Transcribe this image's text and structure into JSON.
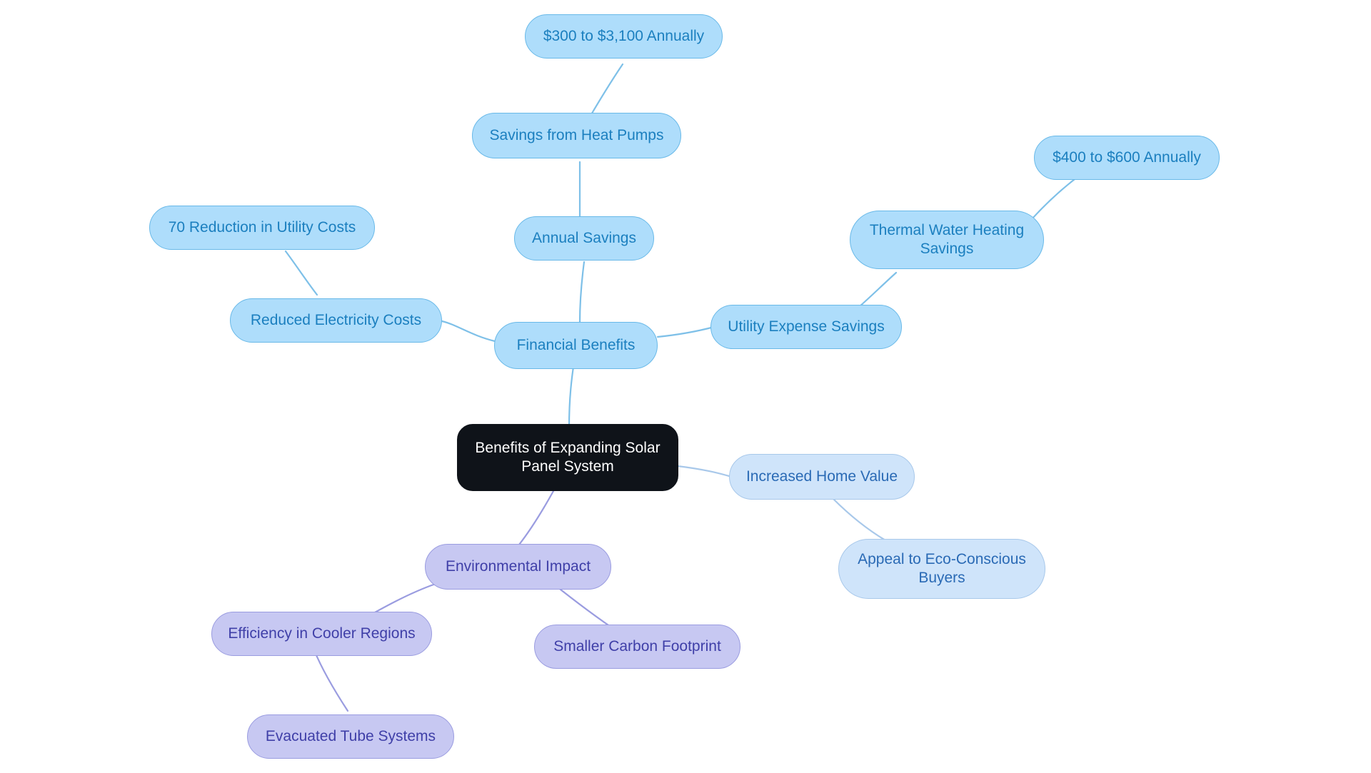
{
  "diagram": {
    "type": "mind-map",
    "title": "Benefits of Expanding Solar Panel System",
    "background_color": "#ffffff",
    "palette": {
      "root_fill": "#0f1319",
      "root_text": "#ffffff",
      "financial_fill": "#aeddfb",
      "financial_border": "#69b9e8",
      "financial_text": "#1b7fbf",
      "home_value_fill": "#cfe4fa",
      "home_value_border": "#a8c8ea",
      "home_value_text": "#2a6ab5",
      "environment_fill": "#c7c8f2",
      "environment_border": "#9a9ce0",
      "environment_text": "#3f3fa8"
    }
  },
  "nodes": {
    "root": {
      "label": "Benefits of Expanding Solar\nPanel System"
    },
    "financial_benefits": {
      "label": "Financial Benefits"
    },
    "reduced_electricity_costs": {
      "label": "Reduced Electricity Costs"
    },
    "utility_cost_reduction": {
      "label": "70 Reduction in Utility Costs"
    },
    "annual_savings": {
      "label": "Annual Savings"
    },
    "savings_heat_pumps": {
      "label": "Savings from Heat Pumps"
    },
    "heat_pump_range": {
      "label": "$300 to $3,100 Annually"
    },
    "utility_expense_savings": {
      "label": "Utility Expense Savings"
    },
    "thermal_water_heating": {
      "label": "Thermal Water Heating\nSavings"
    },
    "thermal_range": {
      "label": "$400 to $600 Annually"
    },
    "increased_home_value": {
      "label": "Increased Home Value"
    },
    "eco_conscious_buyers": {
      "label": "Appeal to Eco-Conscious\nBuyers"
    },
    "environmental_impact": {
      "label": "Environmental Impact"
    },
    "efficiency_cooler_regions": {
      "label": "Efficiency in Cooler Regions"
    },
    "evacuated_tube_systems": {
      "label": "Evacuated Tube Systems"
    },
    "smaller_carbon_footprint": {
      "label": "Smaller Carbon Footprint"
    }
  },
  "edges": [
    {
      "from": "root",
      "to": "financial_benefits",
      "color": "#7ec0e8"
    },
    {
      "from": "root",
      "to": "increased_home_value",
      "color": "#a8c8ea"
    },
    {
      "from": "root",
      "to": "environmental_impact",
      "color": "#9a9ce0"
    },
    {
      "from": "financial_benefits",
      "to": "reduced_electricity_costs",
      "color": "#7ec0e8"
    },
    {
      "from": "financial_benefits",
      "to": "annual_savings",
      "color": "#7ec0e8"
    },
    {
      "from": "financial_benefits",
      "to": "utility_expense_savings",
      "color": "#7ec0e8"
    },
    {
      "from": "reduced_electricity_costs",
      "to": "utility_cost_reduction",
      "color": "#7ec0e8"
    },
    {
      "from": "annual_savings",
      "to": "savings_heat_pumps",
      "color": "#7ec0e8"
    },
    {
      "from": "savings_heat_pumps",
      "to": "heat_pump_range",
      "color": "#7ec0e8"
    },
    {
      "from": "utility_expense_savings",
      "to": "thermal_water_heating",
      "color": "#7ec0e8"
    },
    {
      "from": "thermal_water_heating",
      "to": "thermal_range",
      "color": "#7ec0e8"
    },
    {
      "from": "increased_home_value",
      "to": "eco_conscious_buyers",
      "color": "#a8c8ea"
    },
    {
      "from": "environmental_impact",
      "to": "efficiency_cooler_regions",
      "color": "#9a9ce0"
    },
    {
      "from": "environmental_impact",
      "to": "smaller_carbon_footprint",
      "color": "#9a9ce0"
    },
    {
      "from": "efficiency_cooler_regions",
      "to": "evacuated_tube_systems",
      "color": "#9a9ce0"
    }
  ]
}
